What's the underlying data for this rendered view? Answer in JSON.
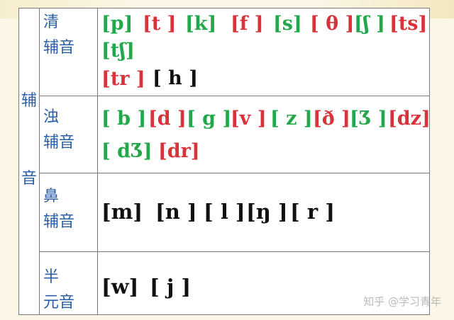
{
  "main_label": [
    "辅",
    "音"
  ],
  "rows": [
    {
      "label": [
        "清",
        "辅音"
      ]
    },
    {
      "label": [
        "浊",
        "辅音"
      ]
    },
    {
      "label": [
        "鼻",
        "辅音"
      ]
    },
    {
      "label": [
        "半",
        "元音"
      ]
    }
  ],
  "symbols": {
    "voiceless": [
      "[p]",
      "[t ]",
      "[k]",
      "[f ]",
      "[s]",
      "[ θ ]",
      "[ʃ ]",
      "[ts]",
      "[tʃ]",
      "[tr ]",
      "[ h ]"
    ],
    "voiced": [
      "[ b ]",
      "[d ]",
      "[ g ]",
      "[v ]",
      "[ z ]",
      "[ð ]",
      "[Ʒ ]",
      "[dz]",
      "[ dƷ]",
      "[dr]"
    ],
    "nasal": [
      "[m]",
      "[n ]",
      "[ l ]",
      "[ŋ ]",
      "[ r ]"
    ],
    "semivowel": [
      "[w]",
      "[ j ]"
    ]
  },
  "colors": {
    "green": "#22a84a",
    "red": "#d8333a",
    "black": "#111111",
    "label": "#2a5fa8"
  },
  "watermark": "知乎 @学习青年"
}
